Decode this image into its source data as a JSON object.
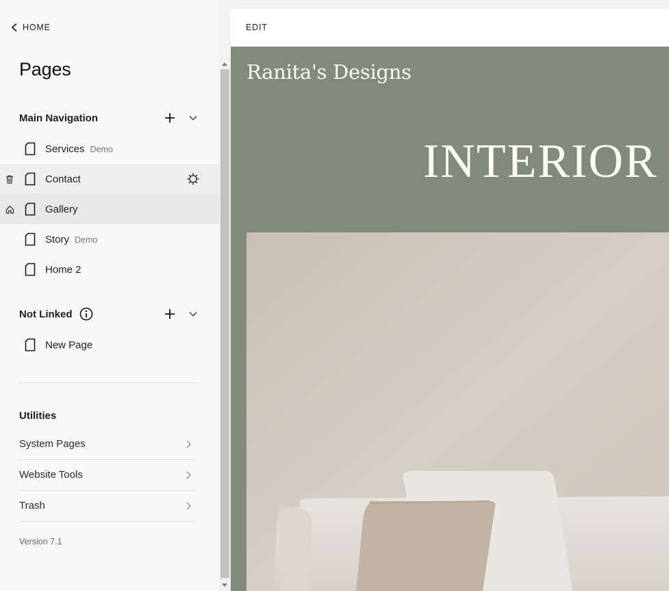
{
  "sidebar": {
    "home_label": "HOME",
    "title": "Pages",
    "main_nav": {
      "label": "Main Navigation",
      "items": [
        {
          "label": "Services",
          "tag": "Demo"
        },
        {
          "label": "Contact",
          "tag": ""
        },
        {
          "label": "Gallery",
          "tag": ""
        },
        {
          "label": "Story",
          "tag": "Demo"
        },
        {
          "label": "Home 2",
          "tag": ""
        }
      ]
    },
    "not_linked": {
      "label": "Not Linked",
      "items": [
        {
          "label": "New Page",
          "tag": ""
        }
      ]
    },
    "utilities": {
      "label": "Utilities",
      "items": [
        {
          "label": "System Pages"
        },
        {
          "label": "Website Tools"
        },
        {
          "label": "Trash"
        }
      ]
    },
    "version": "Version 7.1"
  },
  "preview": {
    "edit_label": "EDIT",
    "site_title": "Ranita's Designs",
    "hero_heading": "INTERIOR F"
  },
  "colors": {
    "hero_bg": "#828b7b",
    "sidebar_bg": "#f8f8f8",
    "selected_row": "#e8e8e8"
  }
}
